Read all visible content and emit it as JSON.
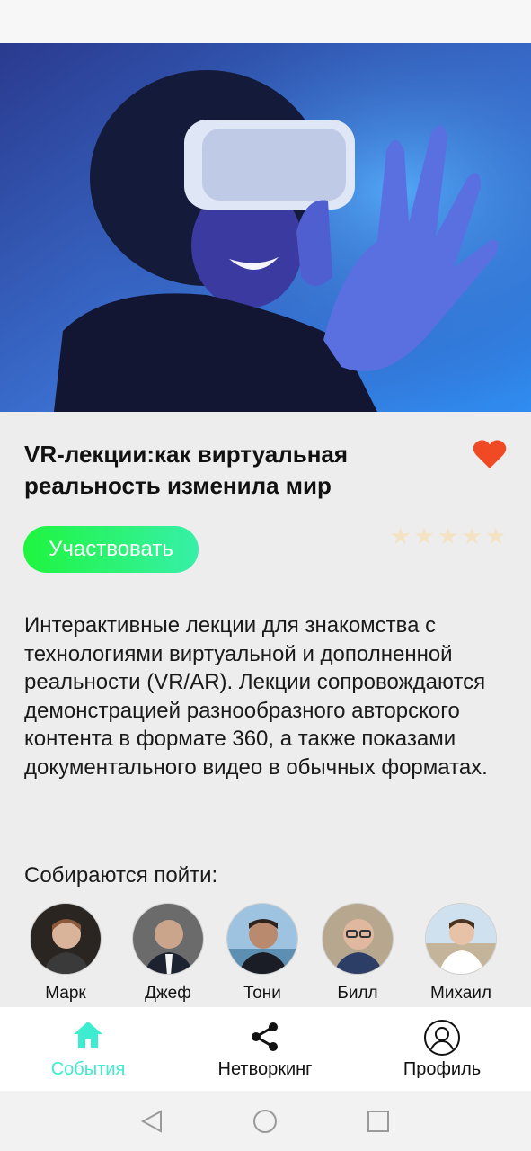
{
  "event": {
    "title": "VR-лекции:как виртуальная реальность изменила мир",
    "join_label": "Участвовать",
    "rating": {
      "value": 0,
      "max": 5
    },
    "favorite": true,
    "description": "Интерактивные лекции для знакомства с технологиями виртуальной и дополненной реальности (VR/AR). Лекции сопровождаются демонстрацией разнообразного авторского контента в формате 360, а также показами документального видео в обычных форматах.",
    "going_label": "Собираются пойти:",
    "attendees": [
      {
        "name": "Марк"
      },
      {
        "name": "Джеф"
      },
      {
        "name": "Тони"
      },
      {
        "name": "Билл"
      },
      {
        "name": "Михаил"
      }
    ]
  },
  "tabs": [
    {
      "label": "События",
      "icon": "home-icon",
      "active": true
    },
    {
      "label": "Нетворкинг",
      "icon": "share-icon",
      "active": false
    },
    {
      "label": "Профиль",
      "icon": "user-icon",
      "active": false
    }
  ],
  "colors": {
    "accent": "#3eecd0",
    "heart": "#f04a24",
    "button_start": "#1ff53f",
    "button_end": "#37f0a8",
    "star_empty": "#f3e3c3"
  }
}
